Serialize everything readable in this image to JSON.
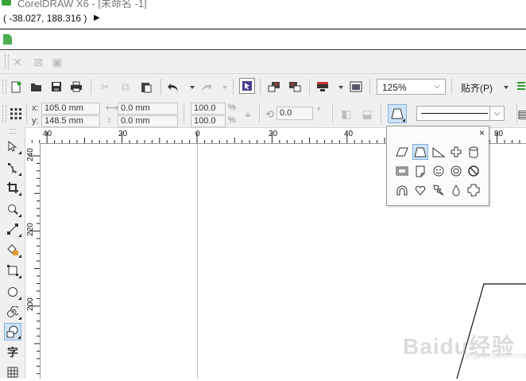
{
  "window": {
    "title": "CorelDRAW X6 - [未命名 -1]"
  },
  "status": {
    "coordinates": "( -38.027, 188.316 )"
  },
  "standard_toolbar": {
    "zoom_level": "125%",
    "snap_label": "贴齐(P)"
  },
  "property_bar": {
    "x_label": "x:",
    "x_value": "105.0 mm",
    "y_label": "y:",
    "y_value": "148.5 mm",
    "width_value": "0.0 mm",
    "height_value": "0.0 mm",
    "scale_w": "100.0",
    "scale_h": "100.0",
    "pct": "%",
    "angle_value": "0.0",
    "degree": "°"
  },
  "rulers": {
    "horizontal": [
      "40",
      "20",
      "0",
      "20",
      "40",
      "80"
    ],
    "vertical": [
      "240",
      "220",
      "200"
    ]
  },
  "toolbox": {
    "text_tool_glyph": "字"
  },
  "flyout": {
    "close_label": "×",
    "shapes": [
      "parallelogram",
      "trapezoid",
      "right-triangle",
      "cross",
      "cylinder",
      "frame",
      "folded-corner",
      "smiley",
      "donut",
      "no-symbol",
      "arch",
      "heart",
      "lightning",
      "teardrop",
      "octagon-plaque"
    ]
  },
  "watermark": {
    "text": "Baidu经验",
    "subtext": "jingyan.baidu.com"
  },
  "colors": {
    "selection": "#cfe3f7",
    "toolbar": "#f0f0f0",
    "accent": "#3aa33a"
  }
}
